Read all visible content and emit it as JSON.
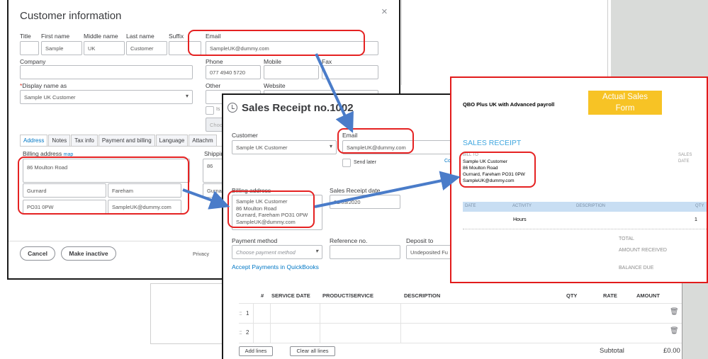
{
  "customer": {
    "title": "Customer information",
    "close_glyph": "×",
    "labels": {
      "title": "Title",
      "first_name": "First name",
      "middle_name": "Middle name",
      "last_name": "Last name",
      "suffix": "Suffix",
      "email": "Email",
      "company": "Company",
      "phone": "Phone",
      "mobile": "Mobile",
      "fax": "Fax",
      "display_name": "Display name as",
      "other": "Other",
      "website": "Website",
      "billing_address": "Billing address",
      "map": "map",
      "shipping": "Shippin"
    },
    "values": {
      "title": "",
      "first_name": "Sample",
      "middle_name": "UK",
      "last_name": "Customer",
      "suffix": "",
      "email": "SampleUK@dummy.com",
      "phone": "077 4940 5720",
      "display_name": "Sample UK Customer",
      "street": "86 Moulton Road",
      "city": "Gurnard",
      "county": "Fareham",
      "postcode": "PO31 0PW",
      "country_email": "SampleUK@dummy.com",
      "ship_street": "86 ",
      "ship_city": "Gurna",
      "is_checkbox": "Is",
      "other_partial": "Choo"
    },
    "tabs": [
      "Address",
      "Notes",
      "Tax info",
      "Payment and billing",
      "Language",
      "Attachm"
    ],
    "buttons": {
      "cancel": "Cancel",
      "make_inactive": "Make inactive"
    },
    "privacy": "Privacy"
  },
  "sales_receipt": {
    "title": "Sales Receipt no.1002",
    "labels": {
      "customer": "Customer",
      "email": "Email",
      "send_later": "Send later",
      "billing_address": "Billing address",
      "receipt_date": "Sales Receipt date",
      "payment_method": "Payment method",
      "reference_no": "Reference no.",
      "deposit_to": "Deposit to",
      "cc_partial": "Co"
    },
    "values": {
      "customer": "Sample UK Customer",
      "email": "SampleUK@dummy.com",
      "billing_lines": [
        "Sample UK Customer",
        "86 Moulton Road",
        "Gurnard, Fareham  PO31 0PW",
        "SampleUK@dummy.com"
      ],
      "receipt_date": "01/03/2020",
      "payment_method_placeholder": "Choose payment method",
      "reference_no": "",
      "deposit_to": "Undeposited Fu"
    },
    "accept_payments_link": "Accept Payments in QuickBooks"
  },
  "line_items": {
    "headers": [
      "#",
      "SERVICE DATE",
      "PRODUCT/SERVICE",
      "DESCRIPTION",
      "QTY",
      "RATE",
      "AMOUNT"
    ],
    "rows": [
      {
        "num": "1"
      },
      {
        "num": "2"
      }
    ],
    "drag_glyph": ":::",
    "trash_glyph": "🗑",
    "buttons": {
      "add_lines": "Add lines",
      "clear_all_lines": "Clear all lines"
    },
    "subtotal_label": "Subtotal",
    "subtotal_value": "£0.00"
  },
  "sales_form": {
    "company": "QBO Plus UK with Advanced payroll",
    "tag_line1": "Actual Sales",
    "tag_line2": "Form",
    "heading": "SALES RECEIPT",
    "bill_to_label": "BILL TO",
    "bill_to_lines": [
      "Sample UK Customer",
      "86 Moulton Road",
      "Gurnard, Fareham  PO31 0PW",
      "SampleUK@dummy.com"
    ],
    "sales_label": "SALES",
    "date_label": "DATE",
    "columns": {
      "date": "DATE",
      "activity": "ACTIVITY",
      "description": "DESCRIPTION",
      "qty": "QTY"
    },
    "row": {
      "activity": "Hours",
      "qty": "1"
    },
    "totals": {
      "total": "TOTAL",
      "amount_received": "AMOUNT RECEIVED",
      "balance_due": "BALANCE DUE"
    }
  },
  "colors": {
    "highlight": "#e52222",
    "arrow": "#4a7cc9",
    "tag_bg": "#f7c325",
    "link": "#0077c5",
    "heading": "#3fa6df"
  }
}
